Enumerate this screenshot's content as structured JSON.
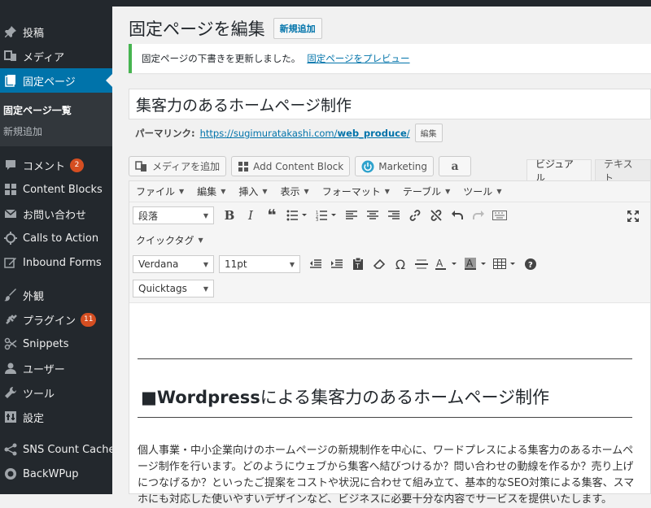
{
  "sidebar": {
    "items": [
      {
        "label": "投稿",
        "icon": "pushpin-icon"
      },
      {
        "label": "メディア",
        "icon": "media-icon"
      },
      {
        "label": "固定ページ",
        "icon": "pages-icon",
        "active": true
      },
      {
        "label": "コメント",
        "icon": "comment-icon",
        "badge": "2"
      },
      {
        "label": "Content Blocks",
        "icon": "blocks-icon"
      },
      {
        "label": "お問い合わせ",
        "icon": "mail-icon"
      },
      {
        "label": "Calls to Action",
        "icon": "crosshair-icon"
      },
      {
        "label": "Inbound Forms",
        "icon": "edit-form-icon"
      },
      {
        "label": "外観",
        "icon": "brush-icon"
      },
      {
        "label": "プラグイン",
        "icon": "plugin-icon",
        "badge": "11"
      },
      {
        "label": "Snippets",
        "icon": "scissors-icon"
      },
      {
        "label": "ユーザー",
        "icon": "user-icon"
      },
      {
        "label": "ツール",
        "icon": "wrench-icon"
      },
      {
        "label": "設定",
        "icon": "settings-icon"
      },
      {
        "label": "SNS Count Cache",
        "icon": "share-icon"
      },
      {
        "label": "BackWPup",
        "icon": "backup-icon"
      }
    ],
    "submenu": [
      {
        "label": "固定ページ一覧",
        "current": true
      },
      {
        "label": "新規追加"
      }
    ]
  },
  "header": {
    "title": "固定ページを編集",
    "add_new": "新規追加"
  },
  "notice": {
    "text": "固定ページの下書きを更新しました。",
    "link": "固定ページをプレビュー"
  },
  "post_title": "集客力のあるホームページ制作",
  "permalink": {
    "label": "パーマリンク:",
    "url_prefix": "https://sugimuratakashi.com/",
    "slug": "web_produce",
    "url_suffix": "/",
    "edit": "編集"
  },
  "media_buttons": [
    {
      "label": "メディアを追加",
      "icon": "media-add-icon"
    },
    {
      "label": "Add Content Block",
      "icon": "grid-icon"
    },
    {
      "label": "Marketing",
      "icon": "power-icon"
    },
    {
      "label": "",
      "icon": "amazon-icon"
    }
  ],
  "editor_tabs": {
    "visual": "ビジュアル",
    "text": "テキスト"
  },
  "menubar": [
    "ファイル",
    "編集",
    "挿入",
    "表示",
    "フォーマット",
    "テーブル",
    "ツール"
  ],
  "toolbar": {
    "format_select": "段落",
    "dropdown_quicktag": "クイックタグ",
    "font_family": "Verdana",
    "font_size": "11pt",
    "quicktags": "Quicktags"
  },
  "content": {
    "heading_mark": "■",
    "heading_bold": "Wordpress",
    "heading_rest": "による集客力のあるホームページ制作",
    "paragraph": "個人事業・中小企業向けのホームページの新規制作を中心に、ワードプレスによる集客力のあるホームページ制作を行います。どのようにウェブから集客へ結びつけるか？問い合わせの動線を作るか？売り上げにつなげるか？といったご提案をコストや状況に合わせて組み立て、基本的なSEO対策による集客、スマホにも対応した使いやすいデザインなど、ビジネスに必要十分な内容でサービスを提供いたします。"
  },
  "colors": {
    "sidebar_bg": "#23282d",
    "accent": "#0073aa",
    "notice_green": "#46b450",
    "badge": "#d54e21"
  }
}
